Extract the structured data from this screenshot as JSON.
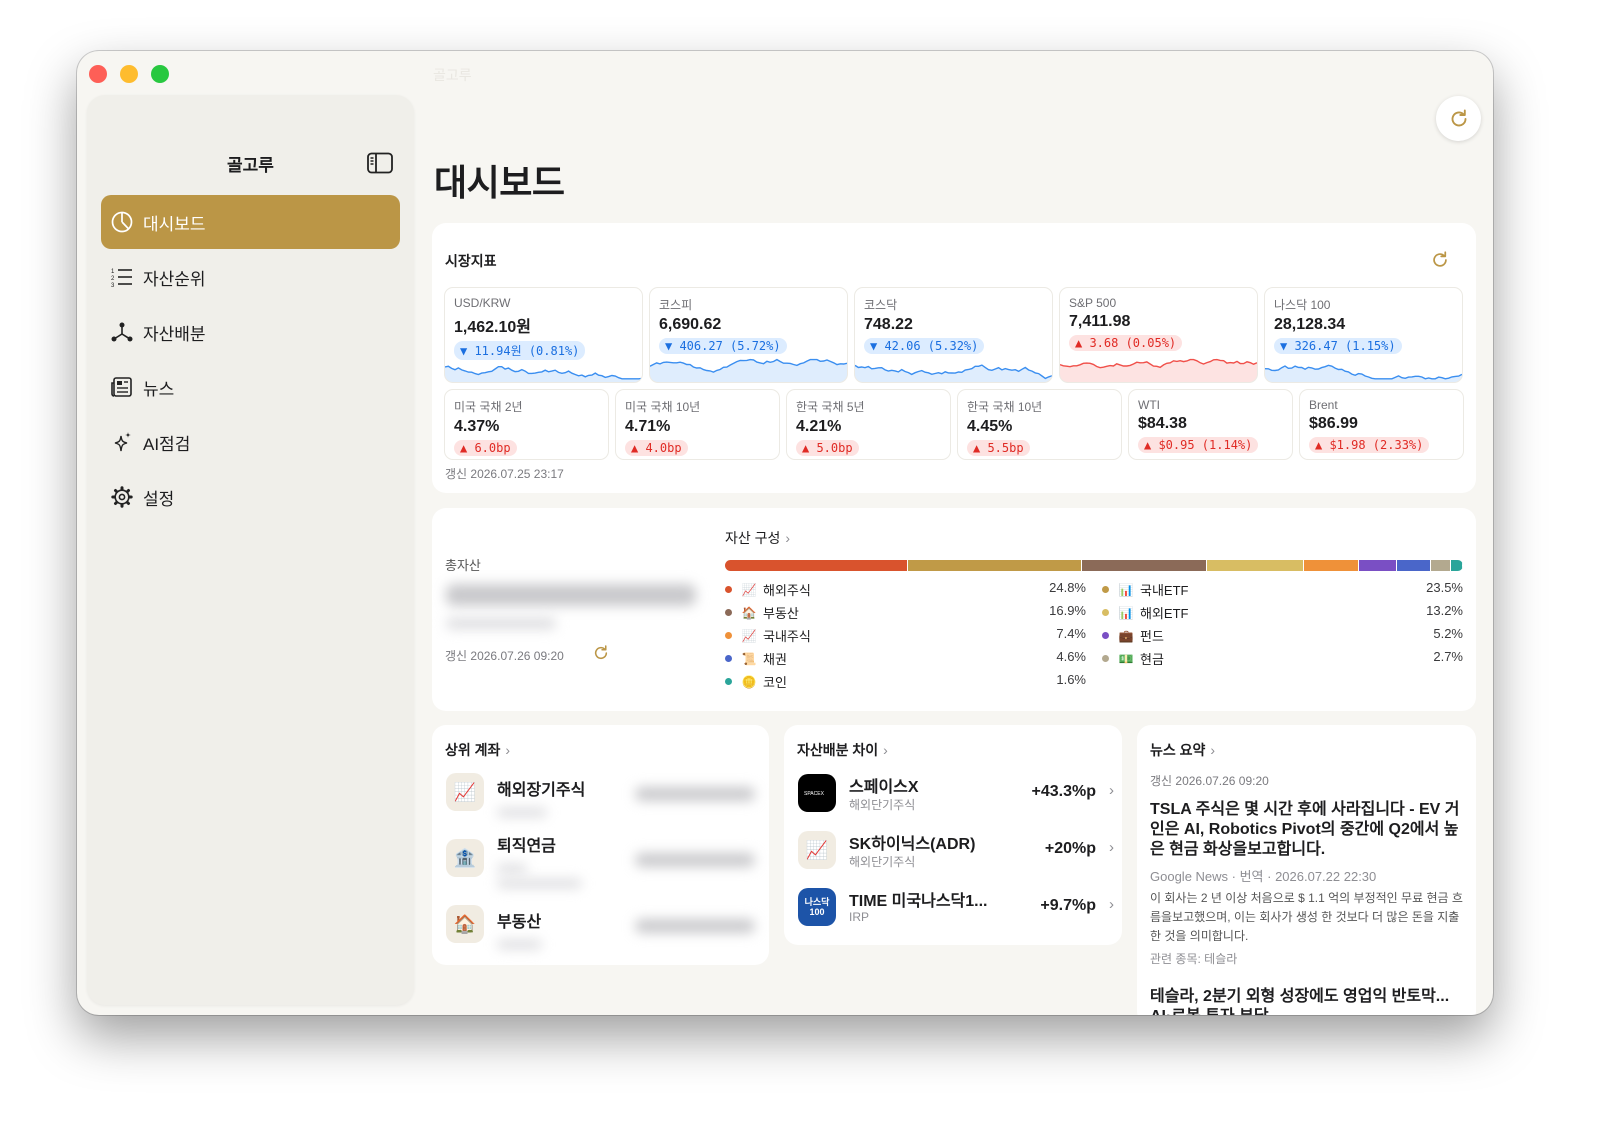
{
  "window": {
    "title": "골고루"
  },
  "sidebar": {
    "title": "골고루",
    "items": [
      {
        "label": "대시보드",
        "icon": "pie-chart-icon",
        "active": true
      },
      {
        "label": "자산순위",
        "icon": "ranked-list-icon"
      },
      {
        "label": "자산배분",
        "icon": "network-icon"
      },
      {
        "label": "뉴스",
        "icon": "newspaper-icon"
      },
      {
        "label": "AI점검",
        "icon": "sparkles-icon"
      },
      {
        "label": "설정",
        "icon": "gear-icon"
      }
    ]
  },
  "page": {
    "title": "대시보드"
  },
  "market": {
    "title": "시장지표",
    "top": [
      {
        "label": "USD/KRW",
        "value": "1,462.10원",
        "change": "▼ 11.94원 (0.81%)",
        "dir": "down"
      },
      {
        "label": "코스피",
        "value": "6,690.62",
        "change": "▼ 406.27 (5.72%)",
        "dir": "down"
      },
      {
        "label": "코스닥",
        "value": "748.22",
        "change": "▼ 42.06 (5.32%)",
        "dir": "down"
      },
      {
        "label": "S&P 500",
        "value": "7,411.98",
        "change": "▲ 3.68 (0.05%)",
        "dir": "up"
      },
      {
        "label": "나스닥 100",
        "value": "28,128.34",
        "change": "▼ 326.47 (1.15%)",
        "dir": "down"
      }
    ],
    "bottom": [
      {
        "label": "미국 국채 2년",
        "value": "4.37%",
        "change": "▲ 6.0bp",
        "dir": "up"
      },
      {
        "label": "미국 국채 10년",
        "value": "4.71%",
        "change": "▲ 4.0bp",
        "dir": "up"
      },
      {
        "label": "한국 국채 5년",
        "value": "4.21%",
        "change": "▲ 5.0bp",
        "dir": "up"
      },
      {
        "label": "한국 국채 10년",
        "value": "4.45%",
        "change": "▲ 5.5bp",
        "dir": "up"
      },
      {
        "label": "WTI",
        "value": "$84.38",
        "change": "▲ $0.95 (1.14%)",
        "dir": "up"
      },
      {
        "label": "Brent",
        "value": "$86.99",
        "change": "▲ $1.98 (2.33%)",
        "dir": "up"
      }
    ],
    "updated": "갱신 2026.07.25 23:17"
  },
  "colors": {
    "accent": "#bb9646",
    "down": "#1b6fe0",
    "up": "#e02b25"
  },
  "asset": {
    "total_label": "총자산",
    "updated": "갱신 2026.07.26 09:20",
    "composition_title": "자산 구성",
    "left": [
      {
        "name": "해외주식",
        "pct": "24.8%",
        "color": "#d9532d",
        "icon": "chart-up-icon"
      },
      {
        "name": "부동산",
        "pct": "16.9%",
        "color": "#8b6a58",
        "icon": "house-icon"
      },
      {
        "name": "국내주식",
        "pct": "7.4%",
        "color": "#ef9139",
        "icon": "chart-up-icon"
      },
      {
        "name": "채권",
        "pct": "4.6%",
        "color": "#4a66c9",
        "icon": "scroll-icon"
      },
      {
        "name": "코인",
        "pct": "1.6%",
        "color": "#2aa59a",
        "icon": "coin-icon"
      }
    ],
    "right": [
      {
        "name": "국내ETF",
        "pct": "23.5%",
        "color": "#c09a47",
        "icon": "bar-chart-icon"
      },
      {
        "name": "해외ETF",
        "pct": "13.2%",
        "color": "#d8bd63",
        "icon": "bar-chart-icon"
      },
      {
        "name": "펀드",
        "pct": "5.2%",
        "color": "#7a4fc4",
        "icon": "briefcase-icon"
      },
      {
        "name": "현금",
        "pct": "2.7%",
        "color": "#b3a98f",
        "icon": "cash-icon"
      }
    ],
    "bar_segments": [
      {
        "name": "해외주식",
        "value": 24.8,
        "color": "#d9532d"
      },
      {
        "name": "국내ETF",
        "value": 23.5,
        "color": "#c09a47"
      },
      {
        "name": "부동산",
        "value": 16.9,
        "color": "#8b6a58"
      },
      {
        "name": "해외ETF",
        "value": 13.2,
        "color": "#d8bd63"
      },
      {
        "name": "국내주식",
        "value": 7.4,
        "color": "#ef9139"
      },
      {
        "name": "펀드",
        "value": 5.2,
        "color": "#7a4fc4"
      },
      {
        "name": "채권",
        "value": 4.6,
        "color": "#4a66c9"
      },
      {
        "name": "현금",
        "value": 2.7,
        "color": "#b3a98f"
      },
      {
        "name": "코인",
        "value": 1.6,
        "color": "#2aa59a"
      }
    ]
  },
  "accounts": {
    "title": "상위 계좌",
    "items": [
      {
        "name": "해외장기주식",
        "icon": "chart-up-icon"
      },
      {
        "name": "퇴직연금",
        "icon": "bank-icon"
      },
      {
        "name": "부동산",
        "icon": "house-icon"
      }
    ]
  },
  "diff": {
    "title": "자산배분 차이",
    "items": [
      {
        "name": "스페이스X",
        "sub": "해외단기주식",
        "value": "+43.3%p",
        "icon": "spacex-logo-icon"
      },
      {
        "name": "SK하이닉스(ADR)",
        "sub": "해외단기주식",
        "value": "+20%p",
        "icon": "chart-up-icon"
      },
      {
        "name": "TIME 미국나스닥1...",
        "sub": "IRP",
        "value": "+9.7%p",
        "icon": "nasdaq100-logo-icon",
        "logo_text_1": "나스닥",
        "logo_text_2": "100"
      }
    ]
  },
  "news": {
    "title": "뉴스 요약",
    "updated": "갱신 2026.07.26 09:20",
    "items": [
      {
        "headline": "TSLA 주식은 몇 시간 후에 사라집니다 - EV 거인은 AI, Robotics Pivot의 중간에 Q2에서 높은 현금 화상을보고합니다.",
        "meta": "Google News · 번역 · 2026.07.22 22:30",
        "summary": "이 회사는 2 년 이상 처음으로 $ 1.1 억의 부정적인 무료 현금 흐름을보고했으며, 이는 회사가 생성 한 것보다 더 많은 돈을 지출 한 것을 의미합니다.",
        "related": "관련 종목: 테슬라"
      },
      {
        "headline": "테슬라, 2분기 외형 성장에도 영업익 반토막...",
        "headline_2": "AI·로봇 투자 부담"
      }
    ]
  }
}
